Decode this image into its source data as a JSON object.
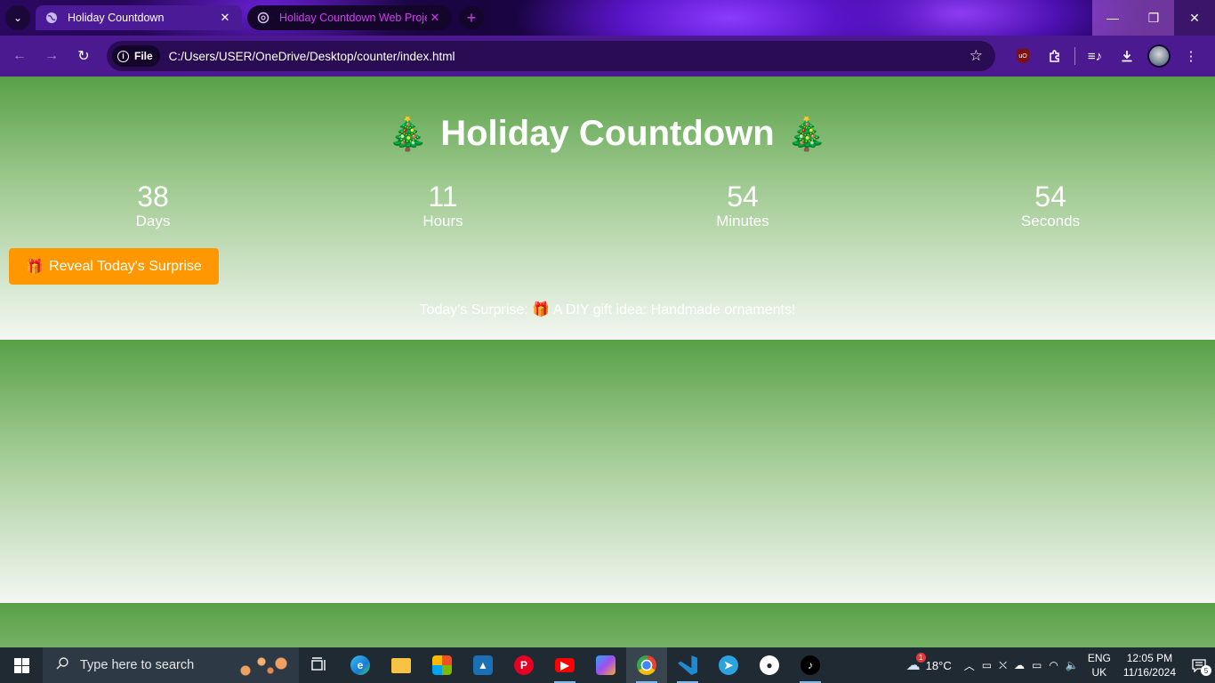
{
  "browser": {
    "tabs": [
      {
        "title": "Holiday Countdown",
        "active": true
      },
      {
        "title": "Holiday Countdown Web Proje",
        "active": false
      }
    ],
    "address": {
      "scheme_chip": "File",
      "url": "C:/Users/USER/OneDrive/Desktop/counter/index.html"
    }
  },
  "page": {
    "title": "Holiday Countdown",
    "title_emoji": "🎄",
    "countdown": [
      {
        "value": "38",
        "label": "Days"
      },
      {
        "value": "11",
        "label": "Hours"
      },
      {
        "value": "54",
        "label": "Minutes"
      },
      {
        "value": "54",
        "label": "Seconds"
      }
    ],
    "reveal_button": {
      "emoji": "🎁",
      "label": "Reveal Today's Surprise"
    },
    "surprise": "Today's Surprise: 🎁 A DIY gift idea: Handmade ornaments!"
  },
  "taskbar": {
    "search_placeholder": "Type here to search",
    "weather": "18°C",
    "weather_badge": "1",
    "language": [
      "ENG",
      "UK"
    ],
    "time": "12:05 PM",
    "date": "11/16/2024",
    "notifications": "5"
  },
  "colors": {
    "page_top": "#58a047",
    "page_bottom": "#f4f7f3",
    "button": "#ff9800",
    "browser_frame": "#4c1a90"
  }
}
